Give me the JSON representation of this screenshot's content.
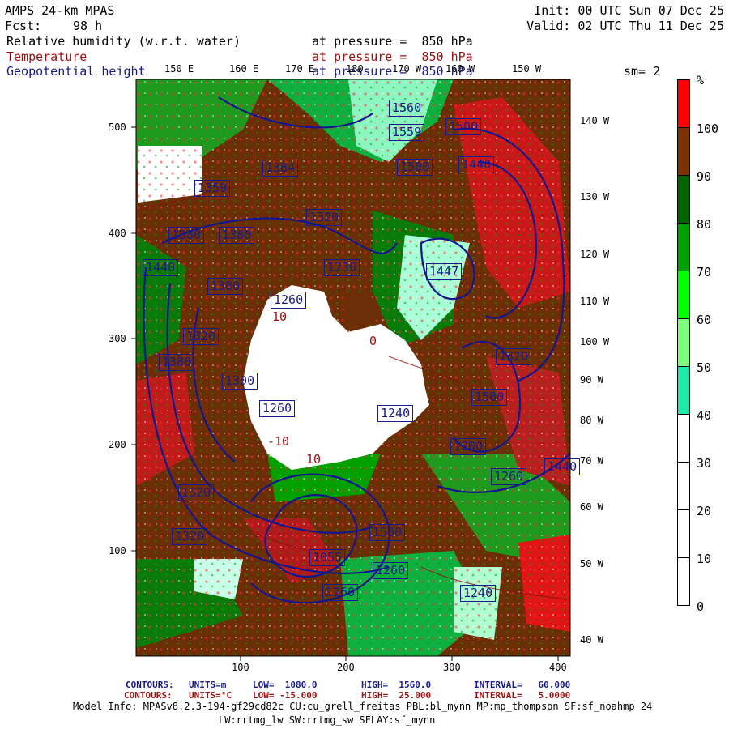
{
  "header": {
    "model": "AMPS 24-km MPAS",
    "fcst_label": "Fcst:",
    "fcst_value": "98 h",
    "init": "Init: 00 UTC Sun 07 Dec 25",
    "valid": "Valid: 02 UTC Thu 11 Dec 25"
  },
  "fields": [
    {
      "name": "Relative humidity (w.r.t. water)",
      "level": "at pressure =  850 hPa",
      "color": "#000000"
    },
    {
      "name": "Temperature",
      "level": "at pressure =  850 hPa",
      "color": "#a01010"
    },
    {
      "name": "Geopotential height",
      "level": "at pressure =  850 hPa",
      "color": "#1a1a8c"
    }
  ],
  "smoothing": "sm= 2",
  "longitude_labels_top": [
    "150 E",
    "160 E",
    "170 E",
    "180",
    "170 W",
    "160 W",
    "150 W"
  ],
  "longitude_labels_right": [
    "140 W",
    "130 W",
    "120 W",
    "110 W",
    "100 W",
    "90 W",
    "80 W",
    "70 W",
    "60 W",
    "50 W",
    "40 W"
  ],
  "y_axis": [
    "500",
    "400",
    "300",
    "200",
    "100"
  ],
  "x_axis": [
    "100",
    "200",
    "300",
    "400"
  ],
  "colorbar": {
    "unit": "%",
    "labels": [
      "100",
      "90",
      "80",
      "70",
      "60",
      "50",
      "40",
      "30",
      "20",
      "10",
      "0"
    ],
    "bands": [
      {
        "color": "#ff0000"
      },
      {
        "color": "#7a3300"
      },
      {
        "color": "#006400"
      },
      {
        "color": "#00a000"
      },
      {
        "color": "#00ff00"
      },
      {
        "color": "#7dff7d"
      },
      {
        "color": "#20e8a8"
      },
      {
        "color": "#ffffff"
      },
      {
        "color": "#ffffff"
      },
      {
        "color": "#ffffff"
      },
      {
        "color": "#ffffff"
      }
    ]
  },
  "contour_labels_height": [
    "1560",
    "1559",
    "1500",
    "1440",
    "1500",
    "1384",
    "1359",
    "1380",
    "1320",
    "1300",
    "1260",
    "1230",
    "1380",
    "1440",
    "1320",
    "1380",
    "1300",
    "1260",
    "1240",
    "1320",
    "1500",
    "1447",
    "1200",
    "1260",
    "1440",
    "1500",
    "1260",
    "1320",
    "1320",
    "1260",
    "1240",
    "1055"
  ],
  "contour_labels_temp": [
    "10",
    "10",
    "-10",
    "0"
  ],
  "contour_info": [
    {
      "label": "CONTOURS:",
      "units": "UNITS=m",
      "low": "LOW=  1080.0",
      "high": "HIGH=  1560.0",
      "interval": "INTERVAL=   60.000",
      "color": "#1a1a8c"
    },
    {
      "label": "CONTOURS:",
      "units": "UNITS=°C",
      "low": "LOW= -15.000",
      "high": "HIGH=  25.000",
      "interval": "INTERVAL=   5.0000",
      "color": "#a01010"
    }
  ],
  "model_info_1": "Model Info: MPASv8.2.3-194-gf29cd82c CU:cu_grell_freitas PBL:bl_mynn MP:mp_thompson SF:sf_noahmp 24",
  "model_info_2": "LW:rrtmg_lw SW:rrtmg_sw SFLAY:sf_mynn"
}
